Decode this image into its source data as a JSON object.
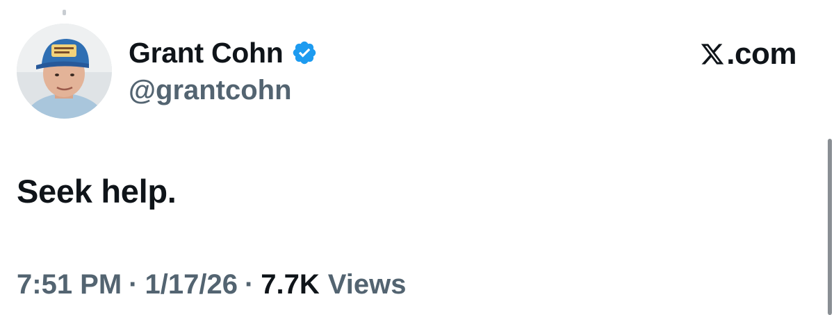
{
  "tweet": {
    "author": {
      "display_name": "Grant Cohn",
      "handle": "@grantcohn",
      "verified_icon": "verified-badge-icon",
      "verified_color": "#1d9bf0"
    },
    "brand": {
      "icon": "x-logo-icon",
      "suffix": ".com"
    },
    "text": "Seek help.",
    "meta": {
      "time": "7:51 PM",
      "date": "1/17/26",
      "separator": "·",
      "view_count": "7.7K",
      "views_label": "Views"
    }
  },
  "colors": {
    "primary_text": "#0f1419",
    "secondary_text": "#536471",
    "background": "#ffffff",
    "accent": "#1d9bf0"
  }
}
